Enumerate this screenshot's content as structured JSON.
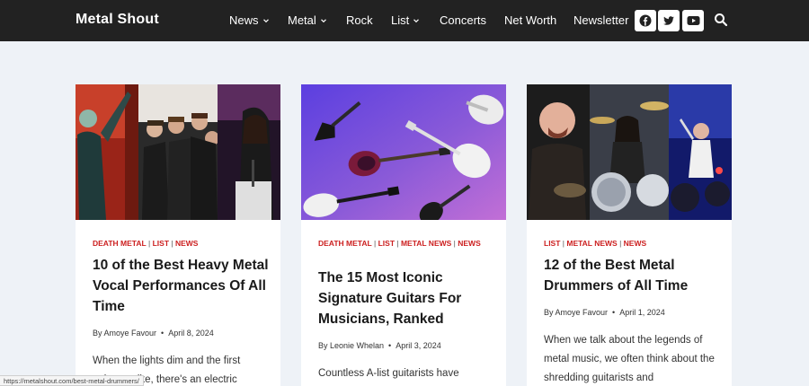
{
  "header": {
    "logo": "Metal Shout",
    "nav": [
      {
        "label": "News",
        "dropdown": true
      },
      {
        "label": "Metal",
        "dropdown": true
      },
      {
        "label": "Rock",
        "dropdown": false
      },
      {
        "label": "List",
        "dropdown": true
      },
      {
        "label": "Concerts",
        "dropdown": false
      },
      {
        "label": "Net Worth",
        "dropdown": false
      },
      {
        "label": "Newsletter",
        "dropdown": false
      }
    ],
    "social": [
      "facebook-icon",
      "twitter-icon",
      "youtube-icon"
    ],
    "search_icon": "search-icon"
  },
  "colors": {
    "header_bg": "#222222",
    "page_bg": "#eef2f7",
    "category": "#cc1f1f"
  },
  "cards": [
    {
      "categories": [
        "DEATH METAL",
        "LIST",
        "NEWS"
      ],
      "title": "10 of the Best Heavy Metal Vocal Performances Of All Time",
      "author": "By Amoye Favour",
      "date": "April 8, 2024",
      "excerpt": "When the lights dim and the first strings strike, there's an electric"
    },
    {
      "categories": [
        "DEATH METAL",
        "LIST",
        "METAL NEWS",
        "NEWS"
      ],
      "title": "The 15 Most Iconic Signature Guitars For Musicians, Ranked",
      "author": "By Leonie Whelan",
      "date": "April 3, 2024",
      "excerpt": "Countless A-list guitarists have"
    },
    {
      "categories": [
        "LIST",
        "METAL NEWS",
        "NEWS"
      ],
      "title": "12 of the Best Metal Drummers of All Time",
      "author": "By Amoye Favour",
      "date": "April 1, 2024",
      "excerpt": "When we talk about the legends of metal music, we often think about the shredding guitarists and"
    }
  ],
  "status_url": "https://metalshout.com/best-metal-drummers/"
}
